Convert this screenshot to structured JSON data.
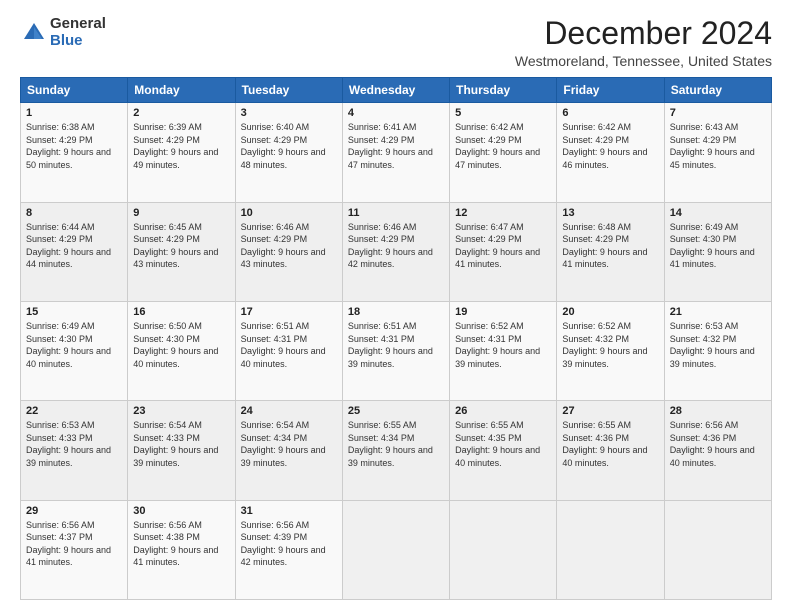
{
  "logo": {
    "general": "General",
    "blue": "Blue"
  },
  "title": "December 2024",
  "location": "Westmoreland, Tennessee, United States",
  "days_header": [
    "Sunday",
    "Monday",
    "Tuesday",
    "Wednesday",
    "Thursday",
    "Friday",
    "Saturday"
  ],
  "weeks": [
    [
      {
        "day": "1",
        "sunrise": "6:38 AM",
        "sunset": "4:29 PM",
        "daylight": "9 hours and 50 minutes."
      },
      {
        "day": "2",
        "sunrise": "6:39 AM",
        "sunset": "4:29 PM",
        "daylight": "9 hours and 49 minutes."
      },
      {
        "day": "3",
        "sunrise": "6:40 AM",
        "sunset": "4:29 PM",
        "daylight": "9 hours and 48 minutes."
      },
      {
        "day": "4",
        "sunrise": "6:41 AM",
        "sunset": "4:29 PM",
        "daylight": "9 hours and 47 minutes."
      },
      {
        "day": "5",
        "sunrise": "6:42 AM",
        "sunset": "4:29 PM",
        "daylight": "9 hours and 47 minutes."
      },
      {
        "day": "6",
        "sunrise": "6:42 AM",
        "sunset": "4:29 PM",
        "daylight": "9 hours and 46 minutes."
      },
      {
        "day": "7",
        "sunrise": "6:43 AM",
        "sunset": "4:29 PM",
        "daylight": "9 hours and 45 minutes."
      }
    ],
    [
      {
        "day": "8",
        "sunrise": "6:44 AM",
        "sunset": "4:29 PM",
        "daylight": "9 hours and 44 minutes."
      },
      {
        "day": "9",
        "sunrise": "6:45 AM",
        "sunset": "4:29 PM",
        "daylight": "9 hours and 43 minutes."
      },
      {
        "day": "10",
        "sunrise": "6:46 AM",
        "sunset": "4:29 PM",
        "daylight": "9 hours and 43 minutes."
      },
      {
        "day": "11",
        "sunrise": "6:46 AM",
        "sunset": "4:29 PM",
        "daylight": "9 hours and 42 minutes."
      },
      {
        "day": "12",
        "sunrise": "6:47 AM",
        "sunset": "4:29 PM",
        "daylight": "9 hours and 41 minutes."
      },
      {
        "day": "13",
        "sunrise": "6:48 AM",
        "sunset": "4:29 PM",
        "daylight": "9 hours and 41 minutes."
      },
      {
        "day": "14",
        "sunrise": "6:49 AM",
        "sunset": "4:30 PM",
        "daylight": "9 hours and 41 minutes."
      }
    ],
    [
      {
        "day": "15",
        "sunrise": "6:49 AM",
        "sunset": "4:30 PM",
        "daylight": "9 hours and 40 minutes."
      },
      {
        "day": "16",
        "sunrise": "6:50 AM",
        "sunset": "4:30 PM",
        "daylight": "9 hours and 40 minutes."
      },
      {
        "day": "17",
        "sunrise": "6:51 AM",
        "sunset": "4:31 PM",
        "daylight": "9 hours and 40 minutes."
      },
      {
        "day": "18",
        "sunrise": "6:51 AM",
        "sunset": "4:31 PM",
        "daylight": "9 hours and 39 minutes."
      },
      {
        "day": "19",
        "sunrise": "6:52 AM",
        "sunset": "4:31 PM",
        "daylight": "9 hours and 39 minutes."
      },
      {
        "day": "20",
        "sunrise": "6:52 AM",
        "sunset": "4:32 PM",
        "daylight": "9 hours and 39 minutes."
      },
      {
        "day": "21",
        "sunrise": "6:53 AM",
        "sunset": "4:32 PM",
        "daylight": "9 hours and 39 minutes."
      }
    ],
    [
      {
        "day": "22",
        "sunrise": "6:53 AM",
        "sunset": "4:33 PM",
        "daylight": "9 hours and 39 minutes."
      },
      {
        "day": "23",
        "sunrise": "6:54 AM",
        "sunset": "4:33 PM",
        "daylight": "9 hours and 39 minutes."
      },
      {
        "day": "24",
        "sunrise": "6:54 AM",
        "sunset": "4:34 PM",
        "daylight": "9 hours and 39 minutes."
      },
      {
        "day": "25",
        "sunrise": "6:55 AM",
        "sunset": "4:34 PM",
        "daylight": "9 hours and 39 minutes."
      },
      {
        "day": "26",
        "sunrise": "6:55 AM",
        "sunset": "4:35 PM",
        "daylight": "9 hours and 40 minutes."
      },
      {
        "day": "27",
        "sunrise": "6:55 AM",
        "sunset": "4:36 PM",
        "daylight": "9 hours and 40 minutes."
      },
      {
        "day": "28",
        "sunrise": "6:56 AM",
        "sunset": "4:36 PM",
        "daylight": "9 hours and 40 minutes."
      }
    ],
    [
      {
        "day": "29",
        "sunrise": "6:56 AM",
        "sunset": "4:37 PM",
        "daylight": "9 hours and 41 minutes."
      },
      {
        "day": "30",
        "sunrise": "6:56 AM",
        "sunset": "4:38 PM",
        "daylight": "9 hours and 41 minutes."
      },
      {
        "day": "31",
        "sunrise": "6:56 AM",
        "sunset": "4:39 PM",
        "daylight": "9 hours and 42 minutes."
      },
      null,
      null,
      null,
      null
    ]
  ]
}
